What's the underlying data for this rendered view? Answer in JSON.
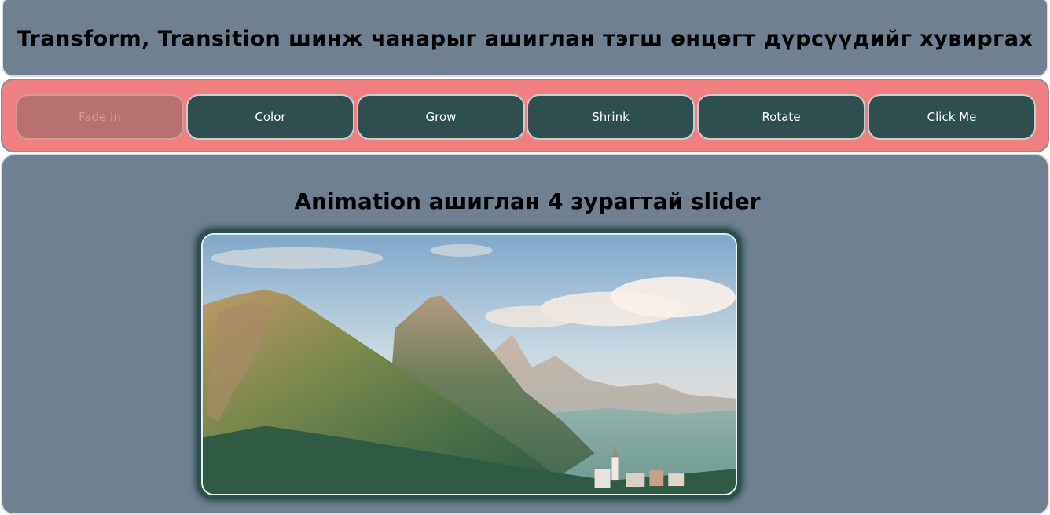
{
  "header": {
    "title": "Transform, Transition шинж чанарыг ашиглан тэгш өнцөгт дүрсүүдийг хувиргах"
  },
  "buttons": [
    {
      "label": "Fade In",
      "state": "faded"
    },
    {
      "label": "Color",
      "state": "normal"
    },
    {
      "label": "Grow",
      "state": "normal"
    },
    {
      "label": "Shrink",
      "state": "normal"
    },
    {
      "label": "Rotate",
      "state": "normal"
    },
    {
      "label": "Click Me",
      "state": "normal"
    }
  ],
  "slider": {
    "heading": "Animation ашиглан 4 зурагтай slider",
    "image_subject": "mountain-landscape"
  },
  "colors": {
    "header_bg": "#708090",
    "buttons_bar_bg": "#f08080",
    "button_bg": "#2f4f4f",
    "button_text": "#ffffff",
    "faded_button_bg": "#b87070"
  }
}
